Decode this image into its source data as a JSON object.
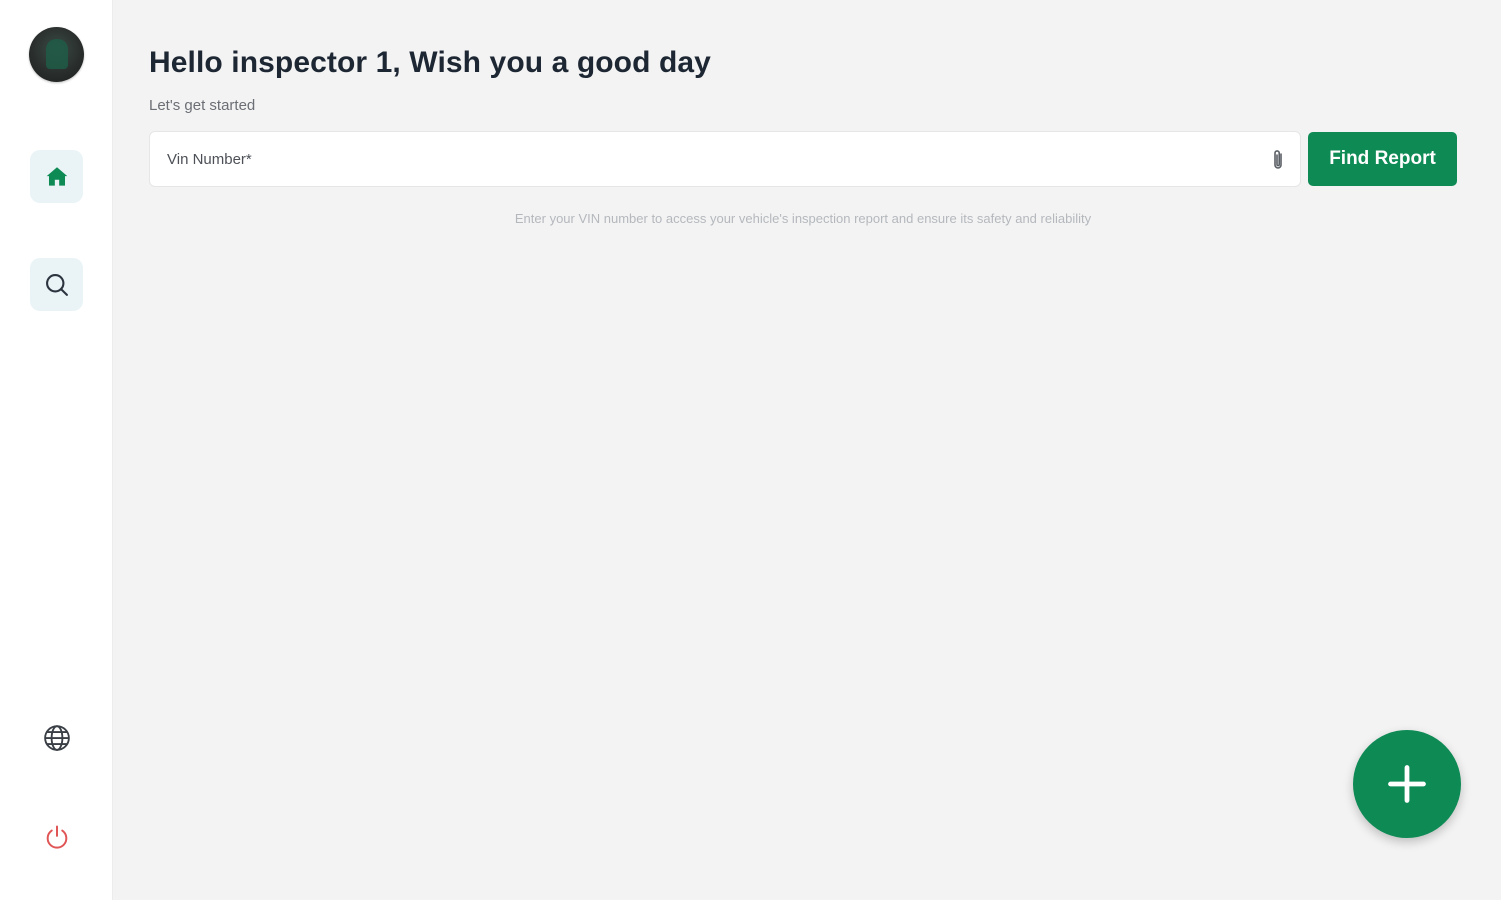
{
  "greeting": {
    "title": "Hello inspector 1, Wish you a good day",
    "subtitle": "Let's get started"
  },
  "sidebar": {
    "avatar_icon": "user-avatar",
    "items": [
      {
        "icon": "home-icon",
        "active": true
      },
      {
        "icon": "search-icon",
        "active": false
      }
    ],
    "bottom_items": [
      {
        "icon": "globe-icon"
      },
      {
        "icon": "power-icon"
      }
    ]
  },
  "search": {
    "placeholder": "Vin Number*",
    "value": "",
    "attach_icon": "paperclip-icon",
    "button_label": "Find Report",
    "hint": "Enter your VIN number to access your vehicle's inspection report and ensure its safety and reliability"
  },
  "fab": {
    "icon": "plus-icon"
  },
  "colors": {
    "accent": "#0e8a55",
    "background": "#f3f3f3",
    "sidebar": "#ffffff",
    "nav_active_bg": "#eaf4f6",
    "power": "#e05555"
  }
}
